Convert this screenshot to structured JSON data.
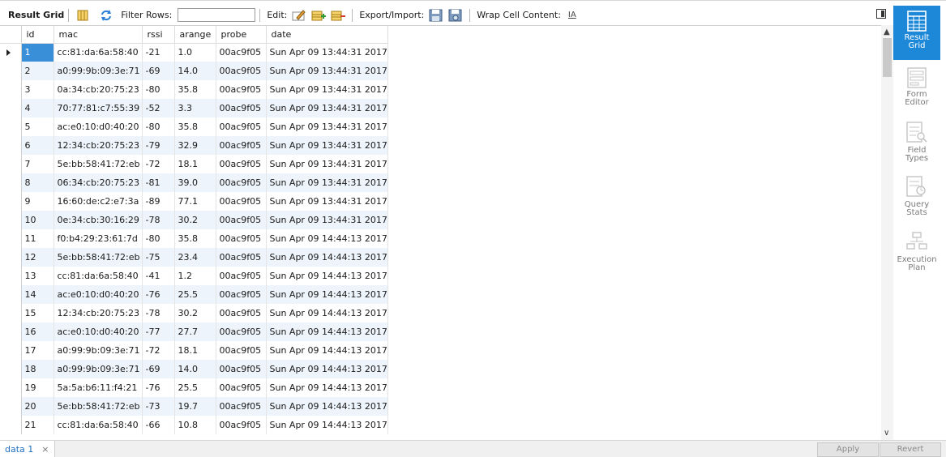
{
  "toolbar": {
    "title": "Result Grid",
    "filter_label": "Filter Rows:",
    "filter_value": "",
    "edit_label": "Edit:",
    "export_label": "Export/Import:",
    "wrap_label": "Wrap Cell Content:",
    "wrap_glyph": "IA"
  },
  "grid": {
    "columns": [
      "id",
      "mac",
      "rssi",
      "arange",
      "probe",
      "date"
    ],
    "rows": [
      [
        "1",
        "cc:81:da:6a:58:40",
        "-21",
        "1.0",
        "00ac9f05",
        "Sun Apr 09 13:44:31 2017"
      ],
      [
        "2",
        "a0:99:9b:09:3e:71",
        "-69",
        "14.0",
        "00ac9f05",
        "Sun Apr 09 13:44:31 2017"
      ],
      [
        "3",
        "0a:34:cb:20:75:23",
        "-80",
        "35.8",
        "00ac9f05",
        "Sun Apr 09 13:44:31 2017"
      ],
      [
        "4",
        "70:77:81:c7:55:39",
        "-52",
        "3.3",
        "00ac9f05",
        "Sun Apr 09 13:44:31 2017"
      ],
      [
        "5",
        "ac:e0:10:d0:40:20",
        "-80",
        "35.8",
        "00ac9f05",
        "Sun Apr 09 13:44:31 2017"
      ],
      [
        "6",
        "12:34:cb:20:75:23",
        "-79",
        "32.9",
        "00ac9f05",
        "Sun Apr 09 13:44:31 2017"
      ],
      [
        "7",
        "5e:bb:58:41:72:eb",
        "-72",
        "18.1",
        "00ac9f05",
        "Sun Apr 09 13:44:31 2017"
      ],
      [
        "8",
        "06:34:cb:20:75:23",
        "-81",
        "39.0",
        "00ac9f05",
        "Sun Apr 09 13:44:31 2017"
      ],
      [
        "9",
        "16:60:de:c2:e7:3a",
        "-89",
        "77.1",
        "00ac9f05",
        "Sun Apr 09 13:44:31 2017"
      ],
      [
        "10",
        "0e:34:cb:30:16:29",
        "-78",
        "30.2",
        "00ac9f05",
        "Sun Apr 09 13:44:31 2017"
      ],
      [
        "11",
        "f0:b4:29:23:61:7d",
        "-80",
        "35.8",
        "00ac9f05",
        "Sun Apr 09 14:44:13 2017"
      ],
      [
        "12",
        "5e:bb:58:41:72:eb",
        "-75",
        "23.4",
        "00ac9f05",
        "Sun Apr 09 14:44:13 2017"
      ],
      [
        "13",
        "cc:81:da:6a:58:40",
        "-41",
        "1.2",
        "00ac9f05",
        "Sun Apr 09 14:44:13 2017"
      ],
      [
        "14",
        "ac:e0:10:d0:40:20",
        "-76",
        "25.5",
        "00ac9f05",
        "Sun Apr 09 14:44:13 2017"
      ],
      [
        "15",
        "12:34:cb:20:75:23",
        "-78",
        "30.2",
        "00ac9f05",
        "Sun Apr 09 14:44:13 2017"
      ],
      [
        "16",
        "ac:e0:10:d0:40:20",
        "-77",
        "27.7",
        "00ac9f05",
        "Sun Apr 09 14:44:13 2017"
      ],
      [
        "17",
        "a0:99:9b:09:3e:71",
        "-72",
        "18.1",
        "00ac9f05",
        "Sun Apr 09 14:44:13 2017"
      ],
      [
        "18",
        "a0:99:9b:09:3e:71",
        "-69",
        "14.0",
        "00ac9f05",
        "Sun Apr 09 14:44:13 2017"
      ],
      [
        "19",
        "5a:5a:b6:11:f4:21",
        "-76",
        "25.5",
        "00ac9f05",
        "Sun Apr 09 14:44:13 2017"
      ],
      [
        "20",
        "5e:bb:58:41:72:eb",
        "-73",
        "19.7",
        "00ac9f05",
        "Sun Apr 09 14:44:13 2017"
      ],
      [
        "21",
        "cc:81:da:6a:58:40",
        "-66",
        "10.8",
        "00ac9f05",
        "Sun Apr 09 14:44:13 2017"
      ]
    ]
  },
  "side_panel": {
    "items": [
      {
        "label_1": "Result",
        "label_2": "Grid",
        "icon": "result-grid-icon"
      },
      {
        "label_1": "Form",
        "label_2": "Editor",
        "icon": "form-editor-icon"
      },
      {
        "label_1": "Field",
        "label_2": "Types",
        "icon": "field-types-icon"
      },
      {
        "label_1": "Query",
        "label_2": "Stats",
        "icon": "query-stats-icon"
      },
      {
        "label_1": "Execution",
        "label_2": "Plan",
        "icon": "execution-plan-icon"
      }
    ]
  },
  "bottom": {
    "tab_label": "data 1",
    "tab_close": "×",
    "apply_label": "Apply",
    "revert_label": "Revert"
  },
  "colors": {
    "accent": "#1e88d8",
    "selected_cell": "#3a8fd9",
    "alt_row": "#eef4fb"
  }
}
